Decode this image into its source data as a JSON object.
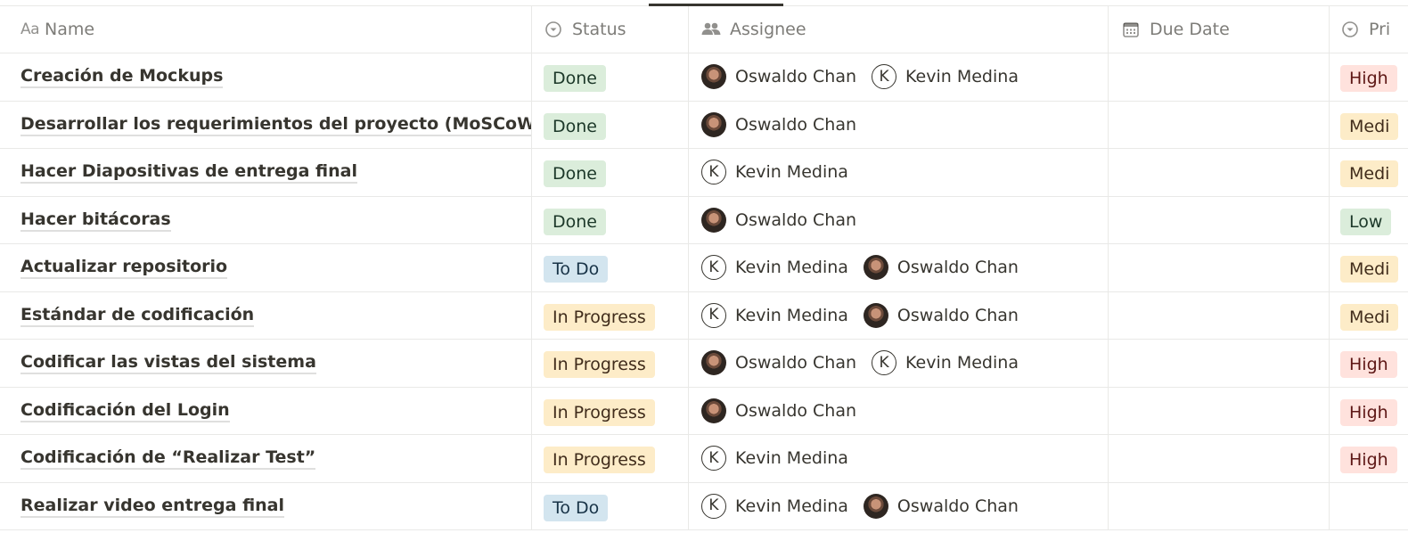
{
  "columns": {
    "name": {
      "label": "Name",
      "icon": "Aa"
    },
    "status": {
      "label": "Status"
    },
    "assignee": {
      "label": "Assignee"
    },
    "due": {
      "label": "Due Date"
    },
    "priority": {
      "label": "Pri"
    }
  },
  "colors": {
    "done_bg": "#dbeddb",
    "todo_bg": "#d3e5ef",
    "in_progress_bg": "#fdecc8",
    "high_bg": "#ffe2dd",
    "medium_bg": "#fdecc8",
    "low_bg": "#dbeddb"
  },
  "people": {
    "oswaldo": {
      "name": "Oswaldo Chan",
      "avatar": "photo"
    },
    "kevin": {
      "name": "Kevin Medina",
      "avatar": "letter",
      "initial": "K"
    }
  },
  "rows": [
    {
      "name": "Creación de Mockups",
      "status": "Done",
      "status_kind": "done",
      "assignees": [
        "oswaldo",
        "kevin"
      ],
      "due": "",
      "priority": "High",
      "priority_kind": "high"
    },
    {
      "name": "Desarrollar los requerimientos del proyecto (MoSCoW)",
      "status": "Done",
      "status_kind": "done",
      "assignees": [
        "oswaldo"
      ],
      "due": "",
      "priority": "Medi",
      "priority_kind": "medium"
    },
    {
      "name": "Hacer Diapositivas de entrega final",
      "status": "Done",
      "status_kind": "done",
      "assignees": [
        "kevin"
      ],
      "due": "",
      "priority": "Medi",
      "priority_kind": "medium"
    },
    {
      "name": "Hacer bitácoras",
      "status": "Done",
      "status_kind": "done",
      "assignees": [
        "oswaldo"
      ],
      "due": "",
      "priority": "Low",
      "priority_kind": "low"
    },
    {
      "name": "Actualizar repositorio",
      "status": "To Do",
      "status_kind": "todo",
      "assignees": [
        "kevin",
        "oswaldo"
      ],
      "due": "",
      "priority": "Medi",
      "priority_kind": "medium"
    },
    {
      "name": "Estándar de codificación",
      "status": "In Progress",
      "status_kind": "inprog",
      "assignees": [
        "kevin",
        "oswaldo"
      ],
      "due": "",
      "priority": "Medi",
      "priority_kind": "medium"
    },
    {
      "name": "Codificar las vistas del sistema",
      "status": "In Progress",
      "status_kind": "inprog",
      "assignees": [
        "oswaldo",
        "kevin"
      ],
      "due": "",
      "priority": "High",
      "priority_kind": "high"
    },
    {
      "name": "Codificación del Login",
      "status": "In Progress",
      "status_kind": "inprog",
      "assignees": [
        "oswaldo"
      ],
      "due": "",
      "priority": "High",
      "priority_kind": "high"
    },
    {
      "name": "Codificación de “Realizar Test”",
      "status": "In Progress",
      "status_kind": "inprog",
      "assignees": [
        "kevin"
      ],
      "due": "",
      "priority": "High",
      "priority_kind": "high"
    },
    {
      "name": "Realizar video entrega final",
      "status": "To Do",
      "status_kind": "todo",
      "assignees": [
        "kevin",
        "oswaldo"
      ],
      "due": "",
      "priority": "",
      "priority_kind": ""
    }
  ]
}
